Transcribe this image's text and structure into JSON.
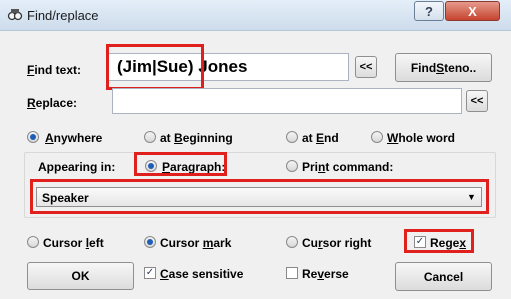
{
  "window": {
    "title": "Find/replace",
    "help_glyph": "?",
    "close_glyph": "X"
  },
  "find": {
    "label_prefix": "",
    "label_u": "F",
    "label_rest": "ind text:",
    "value": "(Jim|Sue) Jones",
    "history_button": "<<",
    "steno_prefix": "Find ",
    "steno_u": "S",
    "steno_rest": "teno.."
  },
  "replace": {
    "label_u": "R",
    "label_rest": "eplace:",
    "value": "",
    "history_button": "<<"
  },
  "position_options": [
    {
      "prefix": "",
      "u": "A",
      "rest": "nywhere",
      "selected": true
    },
    {
      "prefix": "at ",
      "u": "B",
      "rest": "eginning",
      "selected": false
    },
    {
      "prefix": "at ",
      "u": "E",
      "rest": "nd",
      "selected": false
    },
    {
      "prefix": "",
      "u": "W",
      "rest": "hole word",
      "selected": false
    }
  ],
  "appearing": {
    "label": "Appearing in:",
    "paragraph_u": "P",
    "paragraph_rest": "aragraph:",
    "paragraph_selected": true,
    "print_prefix": "Pri",
    "print_u": "n",
    "print_rest": "t command:",
    "print_selected": false,
    "dropdown_value": "Speaker",
    "dropdown_arrow": "▼"
  },
  "cursor_options": [
    {
      "prefix": "Cursor ",
      "u": "l",
      "rest": "eft",
      "selected": false
    },
    {
      "prefix": "Cursor ",
      "u": "m",
      "rest": "ark",
      "selected": true
    },
    {
      "prefix": "Cu",
      "u": "r",
      "rest": "sor right",
      "selected": false
    }
  ],
  "regex": {
    "prefix": "Rege",
    "u": "x",
    "rest": "",
    "checked": true
  },
  "case_sensitive": {
    "prefix": "",
    "u": "C",
    "rest": "ase sensitive",
    "checked": true
  },
  "reverse": {
    "prefix": "Re",
    "u": "v",
    "rest": "erse",
    "checked": false
  },
  "buttons": {
    "ok": "OK",
    "cancel": "Cancel"
  },
  "check_glyph": "✓",
  "colors": {
    "highlight": "#e0201c",
    "radio_dot": "#1e5db8"
  }
}
